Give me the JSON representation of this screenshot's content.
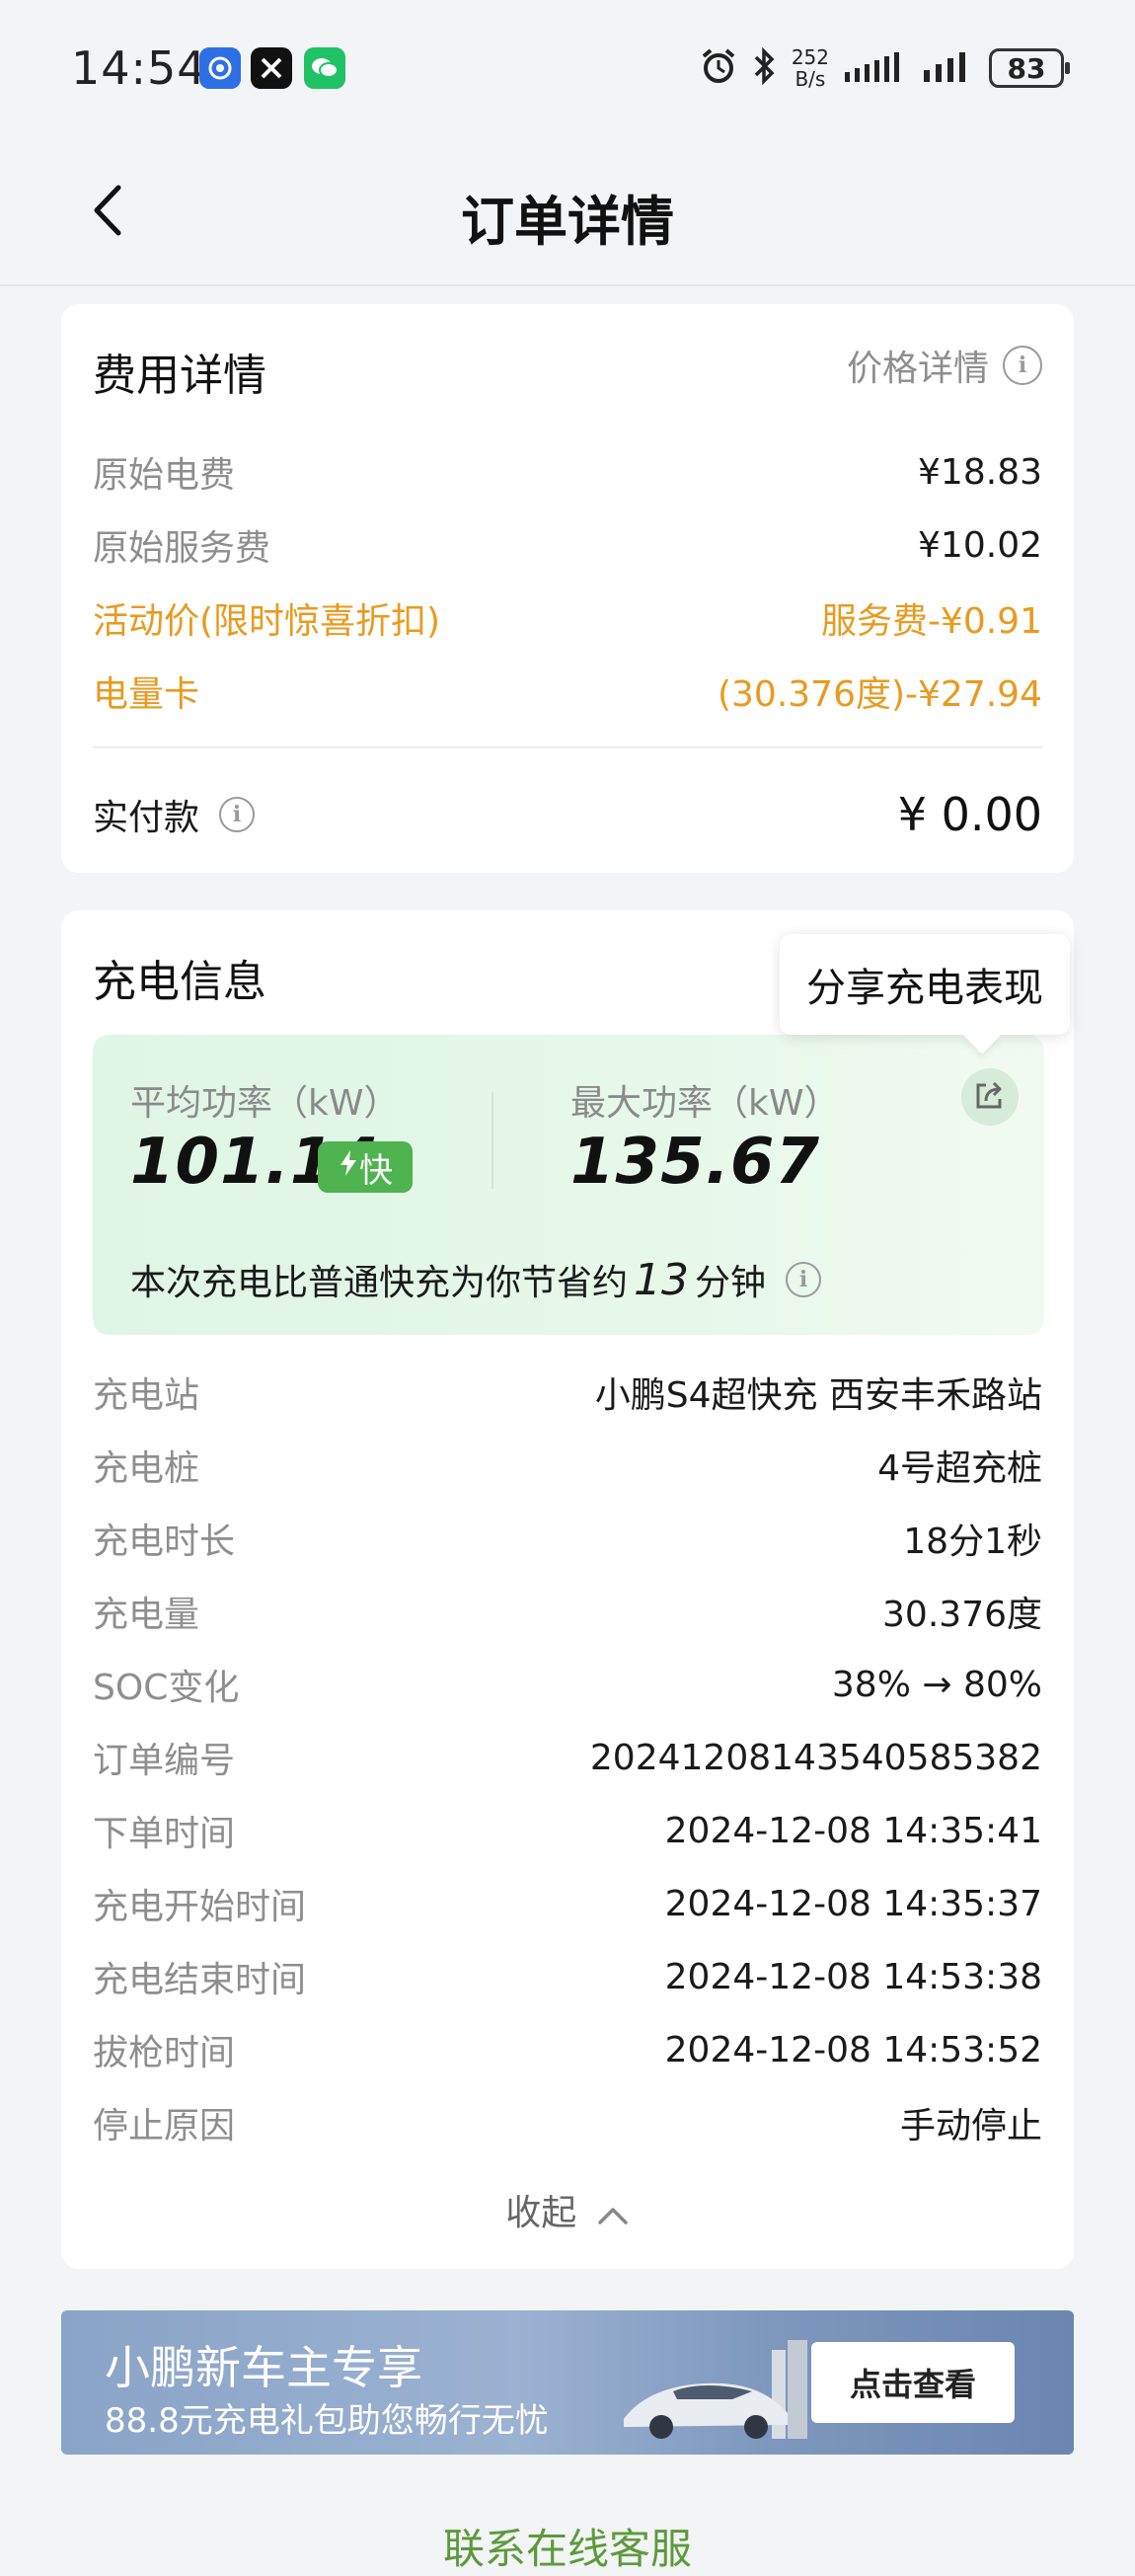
{
  "status_bar": {
    "time": "14:54",
    "net_speed_value": "252",
    "net_speed_unit": "B/s",
    "battery": "83",
    "icons": [
      "baidu-icon",
      "close-app-icon",
      "wechat-icon",
      "alarm-icon",
      "bluetooth-icon",
      "signal-icon",
      "signal-icon"
    ]
  },
  "nav": {
    "title": "订单详情",
    "back_icon": "back-arrow-icon"
  },
  "fee_card": {
    "title": "费用详情",
    "price_detail_link": "价格详情",
    "rows": [
      {
        "label": "原始电费",
        "value": "¥18.83"
      },
      {
        "label": "原始服务费",
        "value": "¥10.02"
      },
      {
        "label": "活动价(限时惊喜折扣)",
        "value": "服务费-¥0.91"
      },
      {
        "label": "电量卡",
        "value": "(30.376度)-¥27.94"
      }
    ],
    "paid_label": "实付款",
    "paid_value": "¥ 0.00"
  },
  "charge_card": {
    "title": "充电信息",
    "tooltip": "分享充电表现",
    "avg_power_label": "平均功率（kW）",
    "avg_power_value": "101.14",
    "fast_badge": "快",
    "max_power_label": "最大功率（kW）",
    "max_power_value": "135.67",
    "saving_prefix": "本次充电比普通快充为你节省约",
    "saving_minutes": "13",
    "saving_suffix": "分钟",
    "rows": [
      {
        "label": "充电站",
        "value": "小鹏S4超快充 西安丰禾路站"
      },
      {
        "label": "充电桩",
        "value": "4号超充桩"
      },
      {
        "label": "充电时长",
        "value": "18分1秒"
      },
      {
        "label": "充电量",
        "value": "30.376度"
      },
      {
        "label": "SOC变化",
        "value": "38% → 80%"
      },
      {
        "label": "订单编号",
        "value": "20241208143540585382"
      },
      {
        "label": "下单时间",
        "value": "2024-12-08 14:35:41"
      },
      {
        "label": "充电开始时间",
        "value": "2024-12-08 14:35:37"
      },
      {
        "label": "充电结束时间",
        "value": "2024-12-08 14:53:38"
      },
      {
        "label": "拔枪时间",
        "value": "2024-12-08 14:53:52"
      },
      {
        "label": "停止原因",
        "value": "手动停止"
      }
    ],
    "collapse_label": "收起"
  },
  "banner": {
    "title": "小鹏新车主专享",
    "subtitle": "88.8元充电礼包助您畅行无忧",
    "button": "点击查看"
  },
  "contact_link": "联系在线客服",
  "colors": {
    "accent_green": "#4fb34f",
    "orange": "#e99a1f",
    "link_green": "#5d9a3d"
  }
}
